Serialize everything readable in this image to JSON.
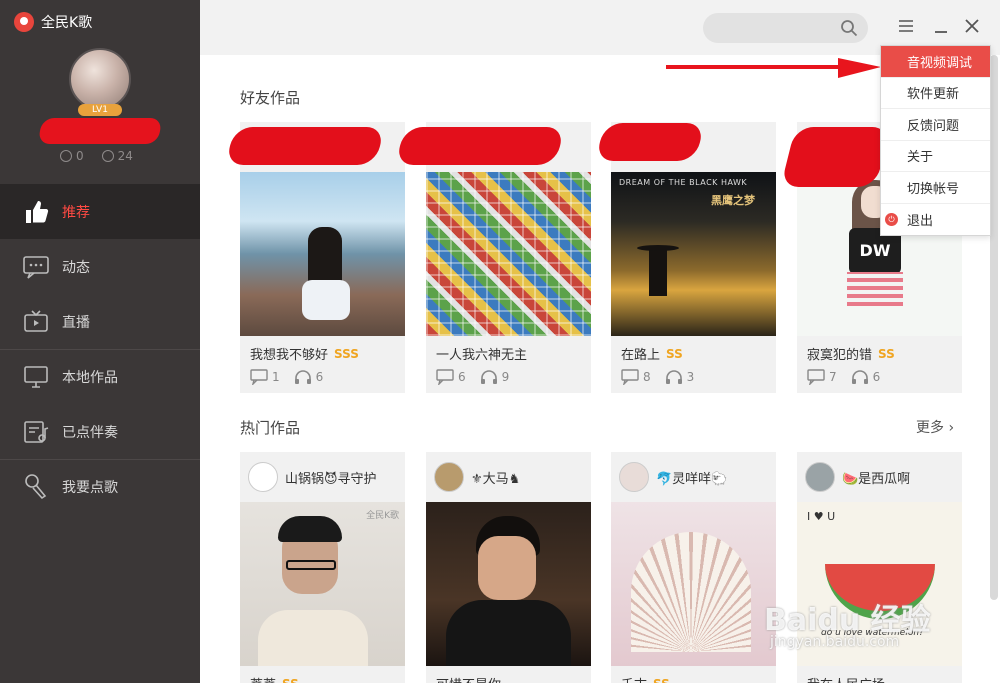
{
  "app": {
    "title": "全民K歌"
  },
  "user": {
    "level": "LV1",
    "stat_a": "0",
    "stat_b": "24"
  },
  "nav": [
    {
      "label": "推荐",
      "icon": "thumbs-up-icon"
    },
    {
      "label": "动态",
      "icon": "chat-icon"
    },
    {
      "label": "直播",
      "icon": "live-tv-icon"
    },
    {
      "label": "本地作品",
      "icon": "monitor-icon"
    },
    {
      "label": "已点伴奏",
      "icon": "music-list-icon"
    },
    {
      "label": "我要点歌",
      "icon": "microphone-icon"
    }
  ],
  "search": {
    "placeholder": ""
  },
  "friends": {
    "title": "好友作品",
    "cards": [
      {
        "title": "我想我不够好",
        "grade": "SSS",
        "comments": "1",
        "listens": "6"
      },
      {
        "title": "一人我六神无主",
        "grade": "",
        "comments": "6",
        "listens": "9"
      },
      {
        "title": "在路上",
        "grade": "SS",
        "comments": "8",
        "listens": "3"
      },
      {
        "title": "寂寞犯的错",
        "grade": "SS",
        "comments": "7",
        "listens": "6"
      }
    ]
  },
  "hot": {
    "title": "热门作品",
    "more": "更多",
    "cards": [
      {
        "user": "山锅锅😈寻守护",
        "title": "莘莘",
        "grade": "SS"
      },
      {
        "user": "⚜大马♞",
        "title": "可惜不是你",
        "grade": ""
      },
      {
        "user": "🐬灵咩咩🐑",
        "title": "千古",
        "grade": "SS"
      },
      {
        "user": "🍉是西瓜啊",
        "title": "我在人民广场",
        "grade": ""
      }
    ]
  },
  "album_text": {
    "dream": "DREAM OF THE BLACK HAWK",
    "blackhawk": "黑鹰之梦",
    "kge": "全民K歌",
    "watermelon": "do u love watermelon?",
    "love": "I ♥ U"
  },
  "menu": [
    {
      "label": "音视频调试"
    },
    {
      "label": "软件更新"
    },
    {
      "label": "反馈问题"
    },
    {
      "label": "关于"
    },
    {
      "label": "切换帐号"
    },
    {
      "label": "退出"
    }
  ],
  "watermark": {
    "main": "Baidu 经验",
    "sub": "jingyan.baidu.com"
  },
  "colors": {
    "accent": "#e94d48",
    "sidebar": "#3b3737",
    "grade": "#f0a521"
  }
}
